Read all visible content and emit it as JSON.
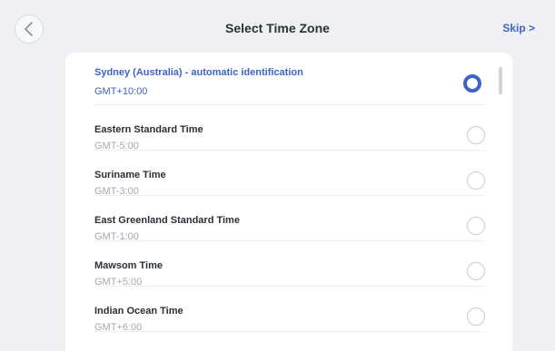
{
  "header": {
    "title": "Select Time Zone",
    "skip_label": "Skip >",
    "back_icon": "chevron-left-icon"
  },
  "timezones": [
    {
      "name": "Sydney (Australia) - automatic identification",
      "offset": "GMT+10:00",
      "selected": true
    },
    {
      "name": "Eastern Standard Time",
      "offset": "GMT-5:00",
      "selected": false
    },
    {
      "name": "Suriname Time",
      "offset": "GMT-3:00",
      "selected": false
    },
    {
      "name": "East Greenland Standard Time",
      "offset": "GMT-1:00",
      "selected": false
    },
    {
      "name": "Mawsom Time",
      "offset": "GMT+5:00",
      "selected": false
    },
    {
      "name": "Indian Ocean Time",
      "offset": "GMT+6:00",
      "selected": false
    }
  ],
  "colors": {
    "accent": "#3d63c4",
    "background": "#eef0f3",
    "card": "#ffffff",
    "muted_text": "#a3a8b0"
  }
}
